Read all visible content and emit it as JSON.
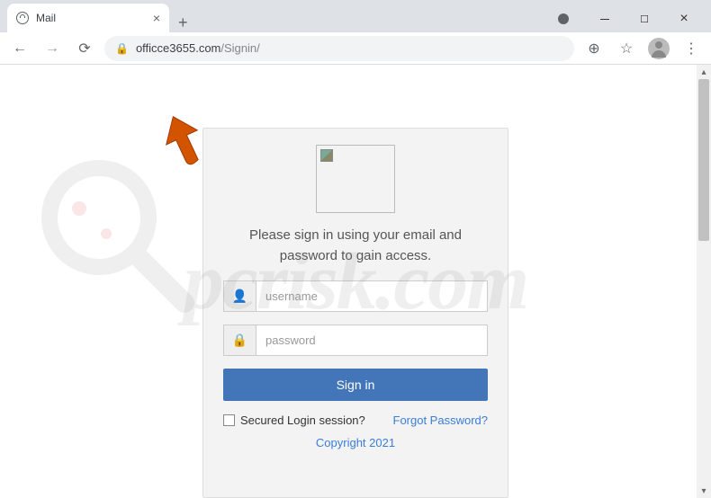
{
  "browser": {
    "tab_title": "Mail",
    "url_domain": "officce3655.com",
    "url_path": "/Signin/"
  },
  "login": {
    "heading": "Please sign in using your email and password to gain access.",
    "username_placeholder": "username",
    "password_placeholder": "password",
    "signin_label": "Sign in",
    "secured_label": "Secured Login session?",
    "forgot_label": "Forgot Password?",
    "copyright": "Copyright 2021"
  },
  "watermark": "pcrisk.com"
}
